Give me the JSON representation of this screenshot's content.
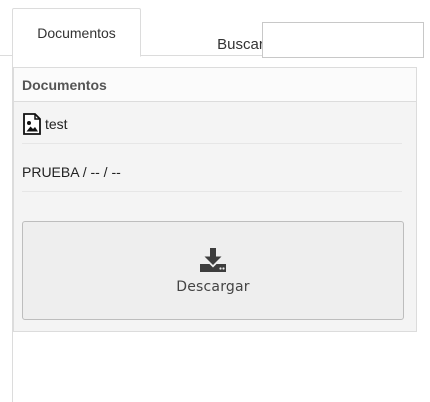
{
  "tabs": [
    {
      "label": "Documentos",
      "active": true
    }
  ],
  "search": {
    "label": "Buscar:",
    "value": "",
    "placeholder": ""
  },
  "documents": {
    "header": "Documentos",
    "file": {
      "icon": "image-file-icon",
      "name": "test"
    },
    "description": "PRUEBA / -- / --",
    "download": {
      "icon": "download-icon",
      "label": "Descargar"
    }
  }
}
